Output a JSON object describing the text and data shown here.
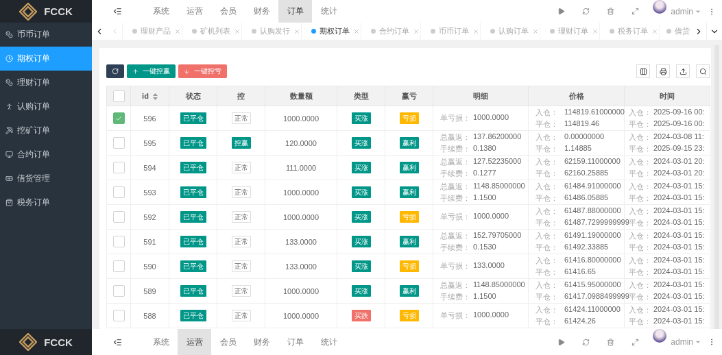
{
  "header": {
    "logo": "FCCK",
    "nav": [
      {
        "label": "系统",
        "selected": false
      },
      {
        "label": "运营",
        "selected": false
      },
      {
        "label": "会员",
        "selected": false
      },
      {
        "label": "财务",
        "selected": false
      },
      {
        "label": "订单",
        "selected": true
      },
      {
        "label": "统计",
        "selected": false
      }
    ],
    "user": "admin"
  },
  "sidebar": {
    "items": [
      {
        "label": "币币订单",
        "selected": false
      },
      {
        "label": "期权订单",
        "selected": true
      },
      {
        "label": "理财订单",
        "selected": false
      },
      {
        "label": "认购订单",
        "selected": false
      },
      {
        "label": "挖矿订单",
        "selected": false
      },
      {
        "label": "合约订单",
        "selected": false
      },
      {
        "label": "借货管理",
        "selected": false
      },
      {
        "label": "税务订单",
        "selected": false
      }
    ]
  },
  "tabs": [
    {
      "label": "理财产品",
      "selected": false
    },
    {
      "label": "矿机列表",
      "selected": false
    },
    {
      "label": "认购发行",
      "selected": false
    },
    {
      "label": "期权订单",
      "selected": true
    },
    {
      "label": "合约订单",
      "selected": false
    },
    {
      "label": "币币订单",
      "selected": false
    },
    {
      "label": "认购订单",
      "selected": false
    },
    {
      "label": "理财订单",
      "selected": false
    },
    {
      "label": "税务订单",
      "selected": false
    },
    {
      "label": "借货",
      "selected": false,
      "cut": true
    }
  ],
  "toolbar": {
    "buttons": [
      {
        "label": "一键控赢",
        "kind": "win"
      },
      {
        "label": "一键控亏",
        "kind": "lose"
      }
    ]
  },
  "table": {
    "all_checked": false,
    "columns": [
      "id",
      "状态",
      "控",
      "数量额",
      "类型",
      "赢亏",
      "明细",
      "价格",
      "时间"
    ],
    "rows": [
      {
        "checked": true,
        "id": "596",
        "status": "已平仓",
        "control": {
          "label": "正常",
          "kind": "normal"
        },
        "amount": "1000.0000",
        "type": {
          "label": "买涨",
          "kind": "up"
        },
        "result": {
          "label": "亏损",
          "kind": "loss"
        },
        "detail": [
          {
            "label": "单亏损：",
            "value": "1000.0000"
          }
        ],
        "price": [
          {
            "label": "入仓：",
            "value": "114819.61000000"
          },
          {
            "label": "平仓：",
            "value": "114819.46"
          }
        ],
        "time": [
          {
            "label": "入仓：",
            "value": "2025-09-16 00:"
          },
          {
            "label": "平仓：",
            "value": "2025-09-16 00:"
          }
        ]
      },
      {
        "checked": false,
        "id": "595",
        "status": "已平仓",
        "control": {
          "label": "控赢",
          "kind": "win"
        },
        "amount": "120.0000",
        "type": {
          "label": "买涨",
          "kind": "up"
        },
        "result": {
          "label": "赢利",
          "kind": "profit"
        },
        "detail": [
          {
            "label": "总赢返：",
            "value": "137.86200000"
          },
          {
            "label": "手续费：",
            "value": "0.1380"
          }
        ],
        "price": [
          {
            "label": "入仓：",
            "value": "0.00000000"
          },
          {
            "label": "平仓：",
            "value": "1.14885"
          }
        ],
        "time": [
          {
            "label": "入仓：",
            "value": "2024-03-08 11:"
          },
          {
            "label": "平仓：",
            "value": "2025-09-15 23:"
          }
        ]
      },
      {
        "checked": false,
        "id": "594",
        "status": "已平仓",
        "control": {
          "label": "正常",
          "kind": "normal"
        },
        "amount": "111.0000",
        "type": {
          "label": "买涨",
          "kind": "up"
        },
        "result": {
          "label": "赢利",
          "kind": "profit"
        },
        "detail": [
          {
            "label": "总赢返：",
            "value": "127.52235000"
          },
          {
            "label": "手续费：",
            "value": "0.1277"
          }
        ],
        "price": [
          {
            "label": "入仓：",
            "value": "62159.11000000"
          },
          {
            "label": "平仓：",
            "value": "62160.25885"
          }
        ],
        "time": [
          {
            "label": "入仓：",
            "value": "2024-03-01 20:"
          },
          {
            "label": "平仓：",
            "value": "2024-03-01 20:"
          }
        ]
      },
      {
        "checked": false,
        "id": "593",
        "status": "已平仓",
        "control": {
          "label": "正常",
          "kind": "normal"
        },
        "amount": "1000.0000",
        "type": {
          "label": "买涨",
          "kind": "up"
        },
        "result": {
          "label": "赢利",
          "kind": "profit"
        },
        "detail": [
          {
            "label": "总赢返：",
            "value": "1148.85000000"
          },
          {
            "label": "手续费：",
            "value": "1.1500"
          }
        ],
        "price": [
          {
            "label": "入仓：",
            "value": "61484.91000000"
          },
          {
            "label": "平仓：",
            "value": "61486.05885"
          }
        ],
        "time": [
          {
            "label": "入仓：",
            "value": "2024-03-01 15:"
          },
          {
            "label": "平仓：",
            "value": "2024-03-01 15:"
          }
        ]
      },
      {
        "checked": false,
        "id": "592",
        "status": "已平仓",
        "control": {
          "label": "正常",
          "kind": "normal"
        },
        "amount": "1000.0000",
        "type": {
          "label": "买涨",
          "kind": "up"
        },
        "result": {
          "label": "亏损",
          "kind": "loss"
        },
        "detail": [
          {
            "label": "单亏损：",
            "value": "1000.0000"
          }
        ],
        "price": [
          {
            "label": "入仓：",
            "value": "61487.88000000"
          },
          {
            "label": "平仓：",
            "value": "61487.7299999999"
          }
        ],
        "time": [
          {
            "label": "入仓：",
            "value": "2024-03-01 15:"
          },
          {
            "label": "平仓：",
            "value": "2024-03-01 15:"
          }
        ]
      },
      {
        "checked": false,
        "id": "591",
        "status": "已平仓",
        "control": {
          "label": "正常",
          "kind": "normal"
        },
        "amount": "133.0000",
        "type": {
          "label": "买涨",
          "kind": "up"
        },
        "result": {
          "label": "赢利",
          "kind": "profit"
        },
        "detail": [
          {
            "label": "总赢返：",
            "value": "152.79705000"
          },
          {
            "label": "手续费：",
            "value": "0.1530"
          }
        ],
        "price": [
          {
            "label": "入仓：",
            "value": "61491.19000000"
          },
          {
            "label": "平仓：",
            "value": "61492.33885"
          }
        ],
        "time": [
          {
            "label": "入仓：",
            "value": "2024-03-01 15:"
          },
          {
            "label": "平仓：",
            "value": "2024-03-01 15:"
          }
        ]
      },
      {
        "checked": false,
        "id": "590",
        "status": "已平仓",
        "control": {
          "label": "正常",
          "kind": "normal"
        },
        "amount": "133.0000",
        "type": {
          "label": "买涨",
          "kind": "up"
        },
        "result": {
          "label": "亏损",
          "kind": "loss"
        },
        "detail": [
          {
            "label": "单亏损：",
            "value": "133.0000"
          }
        ],
        "price": [
          {
            "label": "入仓：",
            "value": "61416.80000000"
          },
          {
            "label": "平仓：",
            "value": "61416.65"
          }
        ],
        "time": [
          {
            "label": "入仓：",
            "value": "2024-03-01 15:"
          },
          {
            "label": "平仓：",
            "value": "2024-03-01 15:"
          }
        ]
      },
      {
        "checked": false,
        "id": "589",
        "status": "已平仓",
        "control": {
          "label": "正常",
          "kind": "normal"
        },
        "amount": "1000.0000",
        "type": {
          "label": "买涨",
          "kind": "up"
        },
        "result": {
          "label": "赢利",
          "kind": "profit"
        },
        "detail": [
          {
            "label": "总赢返：",
            "value": "1148.85000000"
          },
          {
            "label": "手续费：",
            "value": "1.1500"
          }
        ],
        "price": [
          {
            "label": "入仓：",
            "value": "61415.95000000"
          },
          {
            "label": "平仓：",
            "value": "61417.0988499999"
          }
        ],
        "time": [
          {
            "label": "入仓：",
            "value": "2024-03-01 15:"
          },
          {
            "label": "平仓：",
            "value": "2024-03-01 15:"
          }
        ]
      },
      {
        "checked": false,
        "id": "588",
        "status": "已平仓",
        "control": {
          "label": "正常",
          "kind": "normal"
        },
        "amount": "1000.0000",
        "type": {
          "label": "买跌",
          "kind": "down"
        },
        "result": {
          "label": "亏损",
          "kind": "loss"
        },
        "detail": [
          {
            "label": "单亏损：",
            "value": "1000.0000"
          }
        ],
        "price": [
          {
            "label": "入仓：",
            "value": "61424.11000000"
          },
          {
            "label": "平仓：",
            "value": "61424.26"
          }
        ],
        "time": [
          {
            "label": "入仓：",
            "value": "2024-03-01 15:"
          },
          {
            "label": "平仓：",
            "value": "2024-03-01 15:"
          }
        ]
      }
    ]
  },
  "footer_header": {
    "logo": "FCCK",
    "nav": [
      {
        "label": "系统",
        "selected": false
      },
      {
        "label": "运营",
        "selected": true
      },
      {
        "label": "会员",
        "selected": false
      },
      {
        "label": "财务",
        "selected": false
      },
      {
        "label": "订单",
        "selected": false
      },
      {
        "label": "统计",
        "selected": false
      }
    ],
    "user": "admin"
  }
}
